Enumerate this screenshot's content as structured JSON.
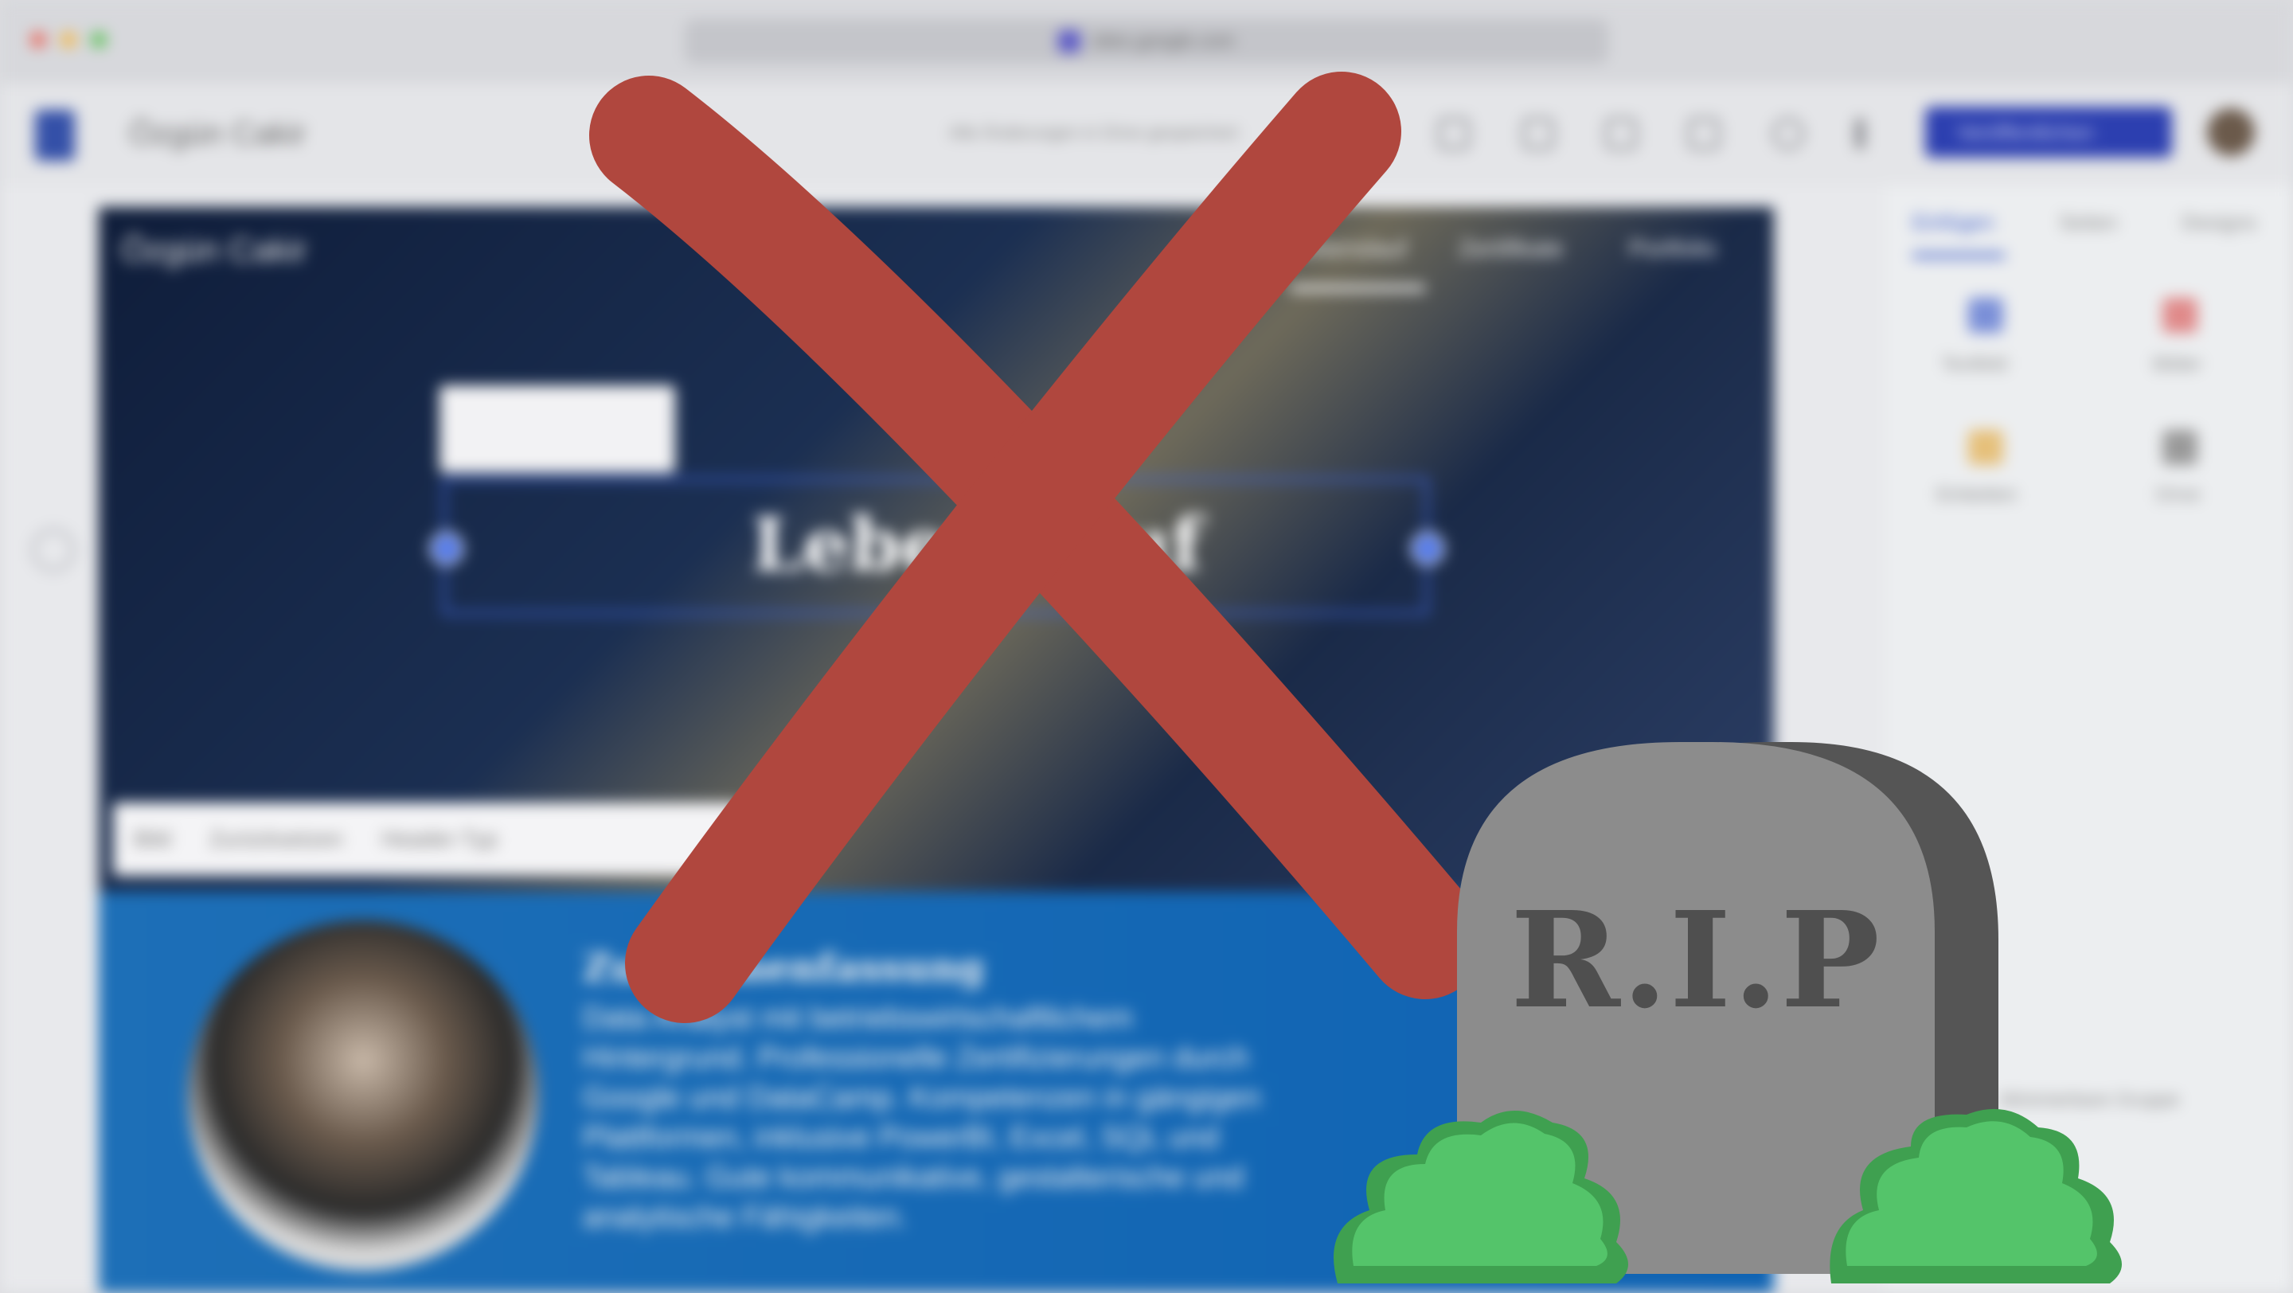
{
  "browser": {
    "url": "sites.google.com"
  },
  "editor": {
    "site_title": "Özgün Cakir",
    "save_status": "Alle Änderungen in Drive gespeichert",
    "publish_label": "Veröffentlichen"
  },
  "hero": {
    "site_name": "Özgün Cakir",
    "nav": [
      "Lebenslauf",
      "Zertifikate",
      "Portfolio"
    ],
    "title": "Lebenslauf",
    "image_toolbar": [
      "Bild",
      "Zurücksetzen",
      "Header-Typ"
    ]
  },
  "summary": {
    "title": "Zusammenfassung",
    "text": "Data Analyst mit betriebswirtschaftlichem Hintergrund. Professionelle Zertifizierungen durch Google und DataCamp. Kompetenzen in gängigen Plattformen, inklusive PowerBI, Excel, SQL und Tableau. Gute kommunikative, gestalterische und analytische Fähigkeiten."
  },
  "panel": {
    "tabs": [
      "Einfügen",
      "Seiten",
      "Designs"
    ],
    "items": [
      "Textfeld",
      "Bilder",
      "Einbetten",
      "Drive"
    ],
    "section_label": "Minimierbare Gruppe"
  },
  "overlay": {
    "tombstone_text": "R.I.P",
    "cross_color": "#b0473e",
    "tombstone_color": "#8c8c8c",
    "bush_color": "#54c46a"
  }
}
